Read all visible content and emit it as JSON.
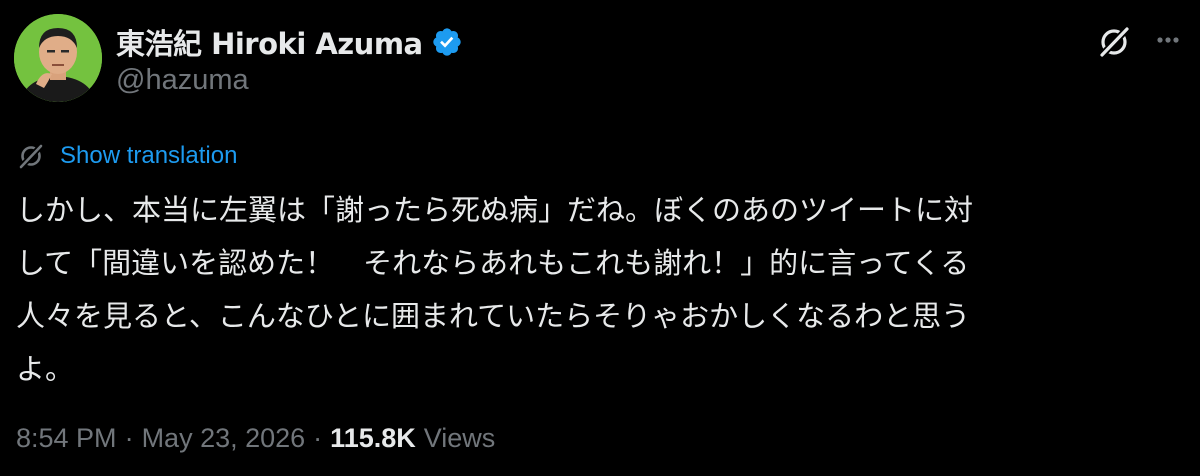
{
  "tweet": {
    "author": {
      "display_name": "東浩紀 Hiroki Azuma",
      "handle": "@hazuma",
      "verified": true,
      "avatar_icon": "user-avatar"
    },
    "actions": {
      "grok_icon": "grok-icon",
      "more_icon": "more-horizontal-icon"
    },
    "translation": {
      "icon": "translate-icon",
      "label": "Show translation"
    },
    "text_lines": [
      "しかし、本当に左翼は「謝ったら死ぬ病」だね。ぼくのあのツイートに対",
      "して「間違いを認めた！　それならあれもこれも謝れ！」的に言ってくる",
      "人々を見ると、こんなひとに囲まれていたらそりゃおかしくなるわと思う",
      "よ。"
    ],
    "meta": {
      "time": "8:54 PM",
      "separator": "·",
      "date": "May 23, 2026",
      "views_count": "115.8K",
      "views_label": "Views"
    }
  },
  "colors": {
    "background": "#000000",
    "text": "#e7e9ea",
    "secondary": "#71767b",
    "link": "#1d9bf0",
    "verified": "#1d9bf0"
  }
}
